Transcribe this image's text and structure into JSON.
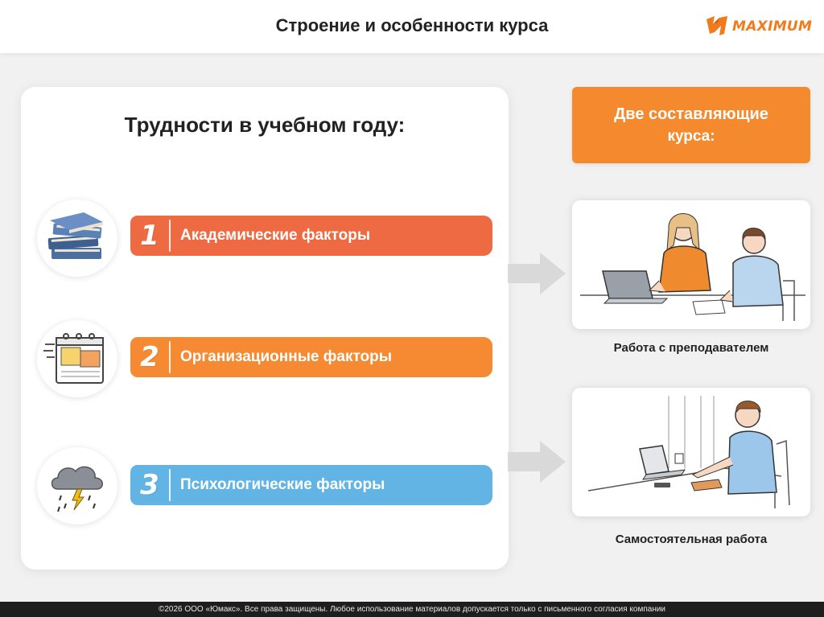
{
  "header": {
    "title": "Строение и особенности курса",
    "logo_text": "MAXIMUM",
    "brand_color": "#f07b1c"
  },
  "difficulties": {
    "title": "Трудности в учебном году:",
    "factors": [
      {
        "number": "1",
        "label": "Академические факторы",
        "color": "#ee6a43",
        "icon": "books-icon"
      },
      {
        "number": "2",
        "label": "Организационные факторы",
        "color": "#f58a33",
        "icon": "calendar-icon"
      },
      {
        "number": "3",
        "label": "Психологические факторы",
        "color": "#62b4e4",
        "icon": "storm-cloud-icon"
      }
    ]
  },
  "course": {
    "title_line1": "Две составляющие",
    "title_line2": "курса:",
    "box_color": "#f5892e",
    "components": [
      {
        "caption": "Работа с преподавателем",
        "illustration": "teacher-and-student-illustration"
      },
      {
        "caption": "Самостоятельная работа",
        "illustration": "self-study-illustration"
      }
    ]
  },
  "footer": {
    "text": "©2026 ООО «Юмакс». Все права защищены. Любое использование материалов допускается только с письменного согласия компании"
  }
}
